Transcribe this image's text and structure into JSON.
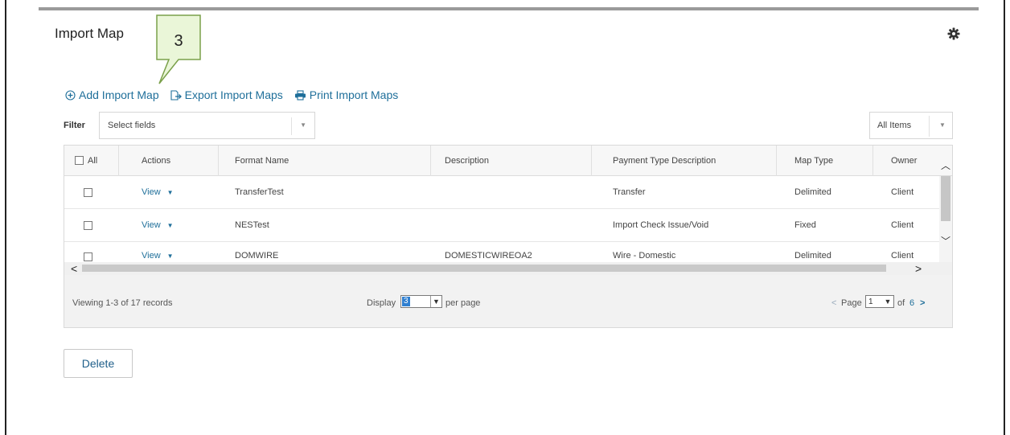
{
  "page": {
    "title": "Import Map"
  },
  "callout": {
    "number": "3"
  },
  "toolbar": {
    "add_label": "Add Import Map",
    "export_label": "Export Import Maps",
    "print_label": "Print Import Maps"
  },
  "filter": {
    "label": "Filter",
    "placeholder": "Select fields",
    "items_value": "All Items"
  },
  "table": {
    "columns": [
      "All",
      "Actions",
      "Format Name",
      "Description",
      "Payment Type Description",
      "Map Type",
      "Owner"
    ],
    "rows": [
      {
        "actions": "View",
        "format_name": "TransferTest",
        "description": "",
        "payment_type": "Transfer",
        "map_type": "Delimited",
        "owner": "Client"
      },
      {
        "actions": "View",
        "format_name": "NESTest",
        "description": "",
        "payment_type": "Import Check Issue/Void",
        "map_type": "Fixed",
        "owner": "Client"
      },
      {
        "actions": "View",
        "format_name": "DOMWIRE",
        "description": "DOMESTICWIREOA2",
        "payment_type": "Wire - Domestic",
        "map_type": "Delimited",
        "owner": "Client"
      }
    ]
  },
  "pagination": {
    "viewing_text": "Viewing 1-3 of 17 records",
    "display_label": "Display",
    "per_page_value": "3",
    "per_page_label": "per page",
    "page_label": "Page",
    "current_page": "1",
    "of_label": "of",
    "total_pages": "6"
  },
  "buttons": {
    "delete_label": "Delete"
  },
  "colors": {
    "link": "#1f6f9a",
    "callout_fill": "#eaf6d8",
    "callout_border": "#7aa04a"
  }
}
